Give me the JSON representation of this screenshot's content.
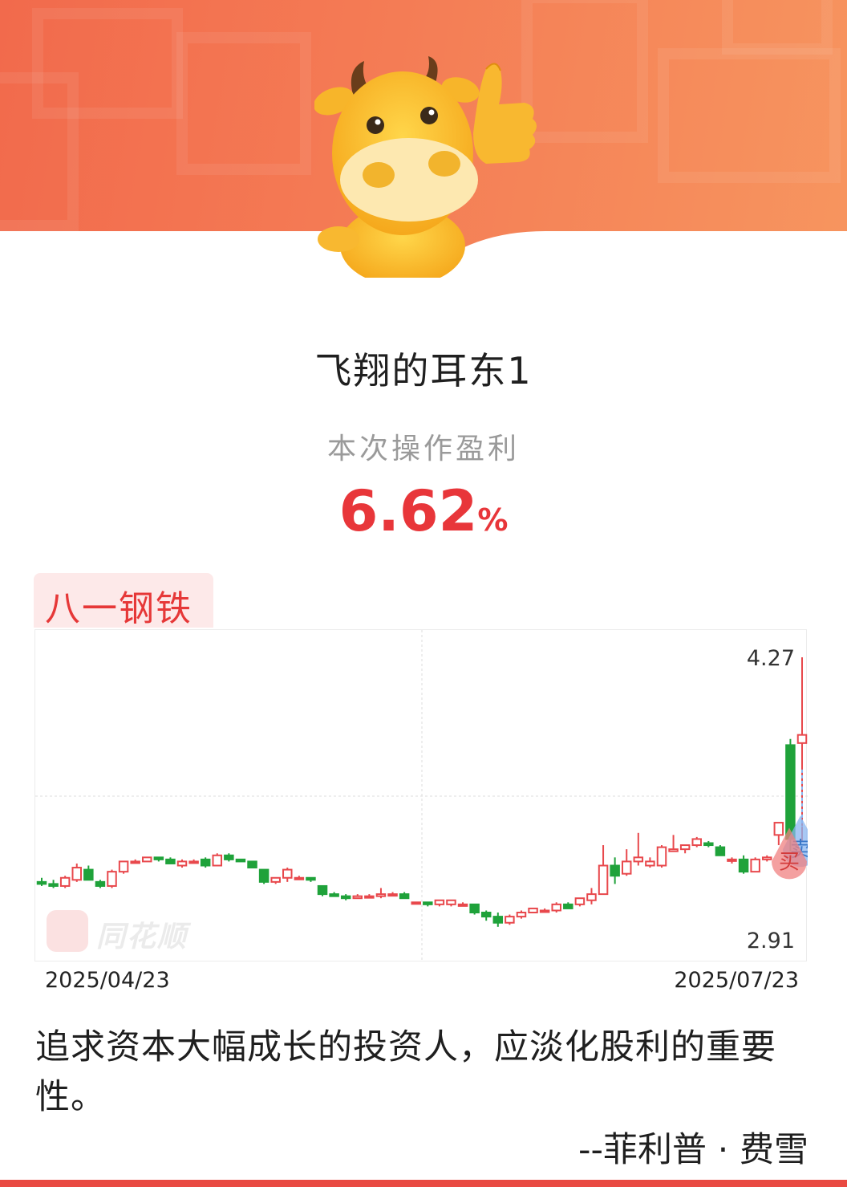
{
  "user": {
    "name": "飞翔的耳东1"
  },
  "profit": {
    "label": "本次操作盈利",
    "value": "6.62",
    "unit": "%"
  },
  "stock": {
    "name": "八一钢铁"
  },
  "chart_data": {
    "type": "candlestick",
    "x_start_label": "2025/04/23",
    "x_end_label": "2025/07/23",
    "y_max_label": "4.27",
    "y_min_label": "2.91",
    "ylim": [
      2.91,
      4.27
    ],
    "markers": [
      {
        "label": "买",
        "type": "buy",
        "color": "#f08080"
      },
      {
        "label": "卖",
        "type": "sell",
        "color": "#8ab6f0"
      }
    ],
    "candles": [
      {
        "o": 3.17,
        "h": 3.19,
        "l": 3.15,
        "c": 3.16
      },
      {
        "o": 3.16,
        "h": 3.18,
        "l": 3.14,
        "c": 3.15
      },
      {
        "o": 3.15,
        "h": 3.2,
        "l": 3.14,
        "c": 3.19
      },
      {
        "o": 3.18,
        "h": 3.26,
        "l": 3.17,
        "c": 3.24
      },
      {
        "o": 3.23,
        "h": 3.25,
        "l": 3.18,
        "c": 3.18
      },
      {
        "o": 3.17,
        "h": 3.18,
        "l": 3.14,
        "c": 3.15
      },
      {
        "o": 3.15,
        "h": 3.23,
        "l": 3.14,
        "c": 3.22
      },
      {
        "o": 3.22,
        "h": 3.27,
        "l": 3.21,
        "c": 3.27
      },
      {
        "o": 3.27,
        "h": 3.28,
        "l": 3.26,
        "c": 3.27
      },
      {
        "o": 3.27,
        "h": 3.29,
        "l": 3.27,
        "c": 3.29
      },
      {
        "o": 3.29,
        "h": 3.29,
        "l": 3.27,
        "c": 3.28
      },
      {
        "o": 3.28,
        "h": 3.29,
        "l": 3.26,
        "c": 3.26
      },
      {
        "o": 3.25,
        "h": 3.28,
        "l": 3.24,
        "c": 3.27
      },
      {
        "o": 3.27,
        "h": 3.28,
        "l": 3.26,
        "c": 3.27
      },
      {
        "o": 3.28,
        "h": 3.29,
        "l": 3.24,
        "c": 3.25
      },
      {
        "o": 3.25,
        "h": 3.31,
        "l": 3.25,
        "c": 3.3
      },
      {
        "o": 3.3,
        "h": 3.31,
        "l": 3.27,
        "c": 3.28
      },
      {
        "o": 3.28,
        "h": 3.28,
        "l": 3.27,
        "c": 3.27
      },
      {
        "o": 3.27,
        "h": 3.27,
        "l": 3.24,
        "c": 3.24
      },
      {
        "o": 3.23,
        "h": 3.23,
        "l": 3.16,
        "c": 3.17
      },
      {
        "o": 3.17,
        "h": 3.19,
        "l": 3.16,
        "c": 3.19
      },
      {
        "o": 3.19,
        "h": 3.24,
        "l": 3.17,
        "c": 3.23
      },
      {
        "o": 3.19,
        "h": 3.2,
        "l": 3.18,
        "c": 3.19
      },
      {
        "o": 3.19,
        "h": 3.19,
        "l": 3.17,
        "c": 3.18
      },
      {
        "o": 3.15,
        "h": 3.15,
        "l": 3.1,
        "c": 3.11
      },
      {
        "o": 3.11,
        "h": 3.12,
        "l": 3.1,
        "c": 3.1
      },
      {
        "o": 3.1,
        "h": 3.11,
        "l": 3.08,
        "c": 3.09
      },
      {
        "o": 3.09,
        "h": 3.11,
        "l": 3.09,
        "c": 3.1
      },
      {
        "o": 3.1,
        "h": 3.11,
        "l": 3.09,
        "c": 3.1
      },
      {
        "o": 3.1,
        "h": 3.14,
        "l": 3.09,
        "c": 3.11
      },
      {
        "o": 3.11,
        "h": 3.12,
        "l": 3.1,
        "c": 3.11
      },
      {
        "o": 3.11,
        "h": 3.12,
        "l": 3.09,
        "c": 3.09
      },
      {
        "o": 3.07,
        "h": 3.07,
        "l": 3.06,
        "c": 3.07
      },
      {
        "o": 3.07,
        "h": 3.07,
        "l": 3.05,
        "c": 3.06
      },
      {
        "o": 3.06,
        "h": 3.08,
        "l": 3.05,
        "c": 3.08
      },
      {
        "o": 3.06,
        "h": 3.08,
        "l": 3.05,
        "c": 3.08
      },
      {
        "o": 3.06,
        "h": 3.07,
        "l": 3.05,
        "c": 3.06
      },
      {
        "o": 3.06,
        "h": 3.06,
        "l": 3.01,
        "c": 3.02
      },
      {
        "o": 3.02,
        "h": 3.03,
        "l": 2.98,
        "c": 3.0
      },
      {
        "o": 3.0,
        "h": 3.02,
        "l": 2.95,
        "c": 2.97
      },
      {
        "o": 2.97,
        "h": 3.01,
        "l": 2.96,
        "c": 3.0
      },
      {
        "o": 3.0,
        "h": 3.03,
        "l": 2.99,
        "c": 3.02
      },
      {
        "o": 3.02,
        "h": 3.04,
        "l": 3.02,
        "c": 3.04
      },
      {
        "o": 3.03,
        "h": 3.04,
        "l": 3.02,
        "c": 3.03
      },
      {
        "o": 3.03,
        "h": 3.07,
        "l": 3.02,
        "c": 3.06
      },
      {
        "o": 3.06,
        "h": 3.07,
        "l": 3.04,
        "c": 3.04
      },
      {
        "o": 3.06,
        "h": 3.09,
        "l": 3.05,
        "c": 3.09
      },
      {
        "o": 3.08,
        "h": 3.14,
        "l": 3.06,
        "c": 3.11
      },
      {
        "o": 3.11,
        "h": 3.35,
        "l": 3.11,
        "c": 3.25
      },
      {
        "o": 3.25,
        "h": 3.29,
        "l": 3.16,
        "c": 3.2
      },
      {
        "o": 3.21,
        "h": 3.33,
        "l": 3.2,
        "c": 3.27
      },
      {
        "o": 3.27,
        "h": 3.41,
        "l": 3.25,
        "c": 3.29
      },
      {
        "o": 3.25,
        "h": 3.29,
        "l": 3.24,
        "c": 3.27
      },
      {
        "o": 3.25,
        "h": 3.35,
        "l": 3.24,
        "c": 3.34
      },
      {
        "o": 3.32,
        "h": 3.4,
        "l": 3.32,
        "c": 3.33
      },
      {
        "o": 3.33,
        "h": 3.35,
        "l": 3.31,
        "c": 3.35
      },
      {
        "o": 3.35,
        "h": 3.39,
        "l": 3.34,
        "c": 3.38
      },
      {
        "o": 3.36,
        "h": 3.37,
        "l": 3.34,
        "c": 3.35
      },
      {
        "o": 3.34,
        "h": 3.35,
        "l": 3.3,
        "c": 3.3
      },
      {
        "o": 3.28,
        "h": 3.29,
        "l": 3.26,
        "c": 3.28
      },
      {
        "o": 3.28,
        "h": 3.3,
        "l": 3.21,
        "c": 3.22
      },
      {
        "o": 3.22,
        "h": 3.29,
        "l": 3.22,
        "c": 3.28
      },
      {
        "o": 3.28,
        "h": 3.3,
        "l": 3.27,
        "c": 3.29
      },
      {
        "o": 3.4,
        "h": 3.43,
        "l": 3.35,
        "c": 3.46
      },
      {
        "o": 3.84,
        "h": 3.87,
        "l": 3.32,
        "c": 3.38
      },
      {
        "o": 3.85,
        "h": 4.27,
        "l": 3.37,
        "c": 3.89
      }
    ]
  },
  "quote": {
    "text": "追求资本大幅成长的投资人，应淡化股利的重要性。",
    "author": "--菲利普 · 费雪"
  },
  "watermark": {
    "text": "同花顺"
  }
}
